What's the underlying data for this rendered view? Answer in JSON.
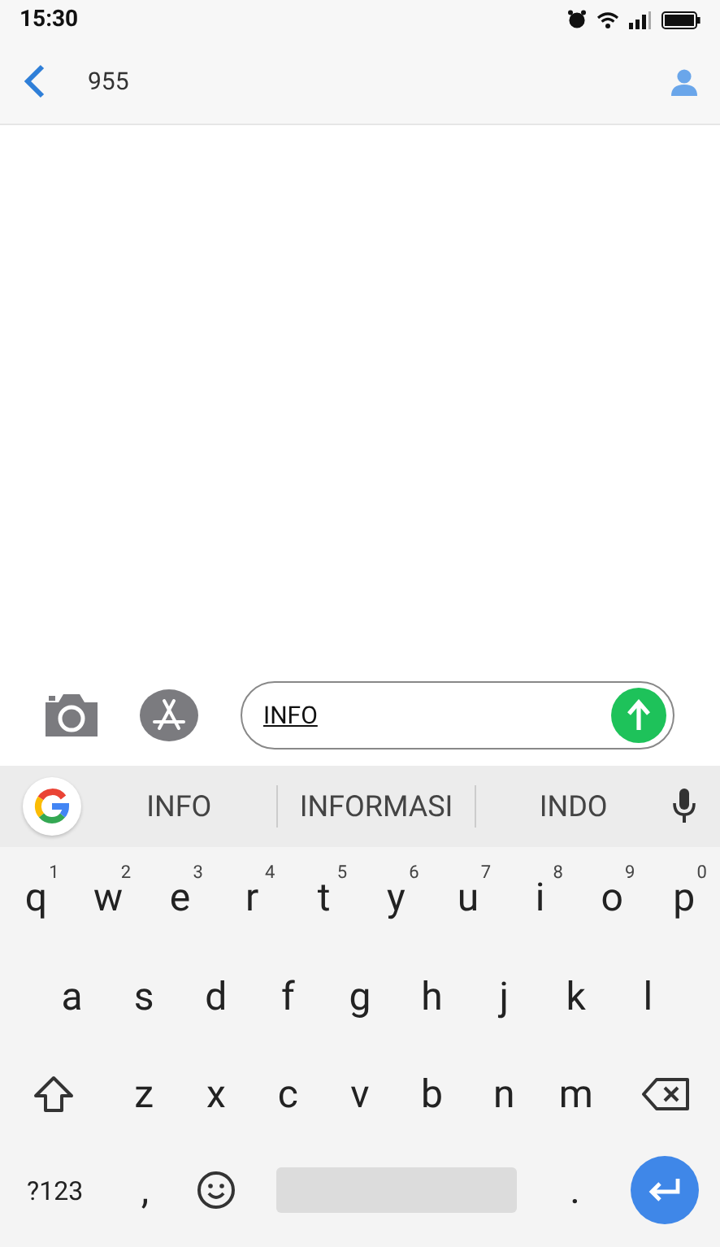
{
  "status_bar": {
    "time": "15:30"
  },
  "header": {
    "title": "955"
  },
  "compose": {
    "value": "INFO"
  },
  "suggestions": [
    {
      "text": "INFO"
    },
    {
      "text": "INFORMASI"
    },
    {
      "text": "INDO"
    }
  ],
  "keyboard": {
    "rows": [
      {
        "keys": [
          {
            "label": "q",
            "hint": "1"
          },
          {
            "label": "w",
            "hint": "2"
          },
          {
            "label": "e",
            "hint": "3"
          },
          {
            "label": "r",
            "hint": "4"
          },
          {
            "label": "t",
            "hint": "5"
          },
          {
            "label": "y",
            "hint": "6"
          },
          {
            "label": "u",
            "hint": "7"
          },
          {
            "label": "i",
            "hint": "8"
          },
          {
            "label": "o",
            "hint": "9"
          },
          {
            "label": "p",
            "hint": "0"
          }
        ]
      },
      {
        "keys": [
          {
            "label": "a"
          },
          {
            "label": "s"
          },
          {
            "label": "d"
          },
          {
            "label": "f"
          },
          {
            "label": "g"
          },
          {
            "label": "h"
          },
          {
            "label": "j"
          },
          {
            "label": "k"
          },
          {
            "label": "l"
          }
        ]
      },
      {
        "keys": [
          {
            "kind": "shift"
          },
          {
            "label": "z"
          },
          {
            "label": "x"
          },
          {
            "label": "c"
          },
          {
            "label": "v"
          },
          {
            "label": "b"
          },
          {
            "label": "n"
          },
          {
            "label": "m"
          },
          {
            "kind": "backspace"
          }
        ]
      },
      {
        "keys": [
          {
            "kind": "symbols",
            "label": "?123"
          },
          {
            "label": ","
          },
          {
            "kind": "emoji"
          },
          {
            "kind": "space"
          },
          {
            "label": "."
          },
          {
            "kind": "enter"
          }
        ]
      }
    ]
  }
}
